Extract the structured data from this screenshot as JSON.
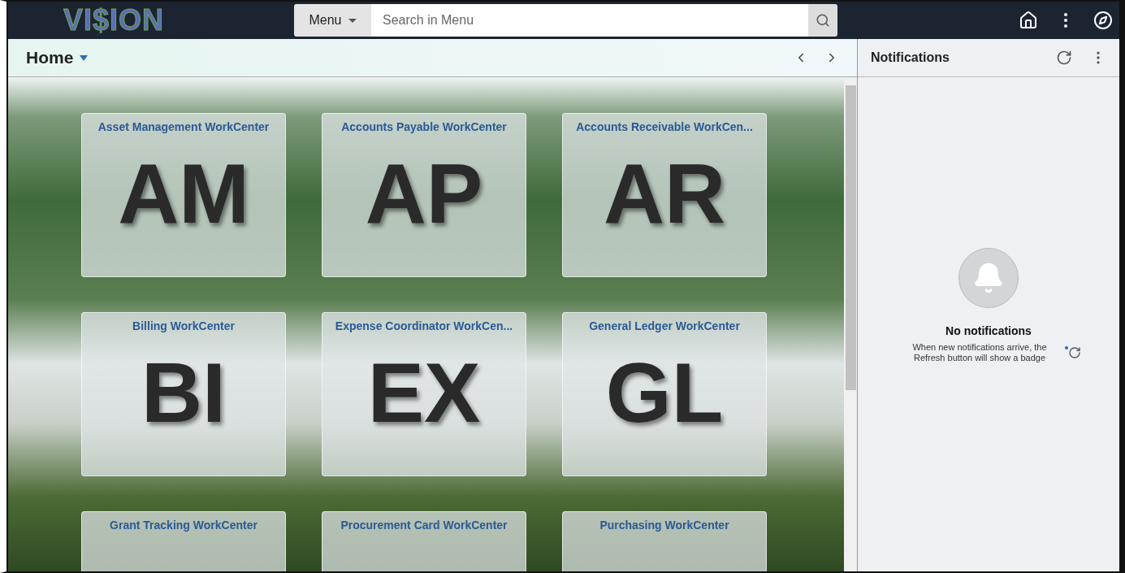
{
  "header": {
    "logo": "VI$ION",
    "menu_button": "Menu",
    "search": {
      "placeholder": "Search in Menu"
    }
  },
  "page_bar": {
    "title": "Home"
  },
  "tiles": [
    {
      "title": "Asset Management WorkCenter",
      "abbr": "AM"
    },
    {
      "title": "Accounts Payable WorkCenter",
      "abbr": "AP"
    },
    {
      "title": "Accounts Receivable WorkCen...",
      "abbr": "AR"
    },
    {
      "title": "Billing WorkCenter",
      "abbr": "BI"
    },
    {
      "title": "Expense Coordinator WorkCen...",
      "abbr": "EX"
    },
    {
      "title": "General Ledger WorkCenter",
      "abbr": "GL"
    },
    {
      "title": "Grant Tracking WorkCenter"
    },
    {
      "title": "Procurement Card WorkCenter"
    },
    {
      "title": "Purchasing WorkCenter"
    }
  ],
  "notifications": {
    "title": "Notifications",
    "empty_title": "No notifications",
    "empty_text": "When new notifications arrive, the Refresh button will show a badge"
  }
}
